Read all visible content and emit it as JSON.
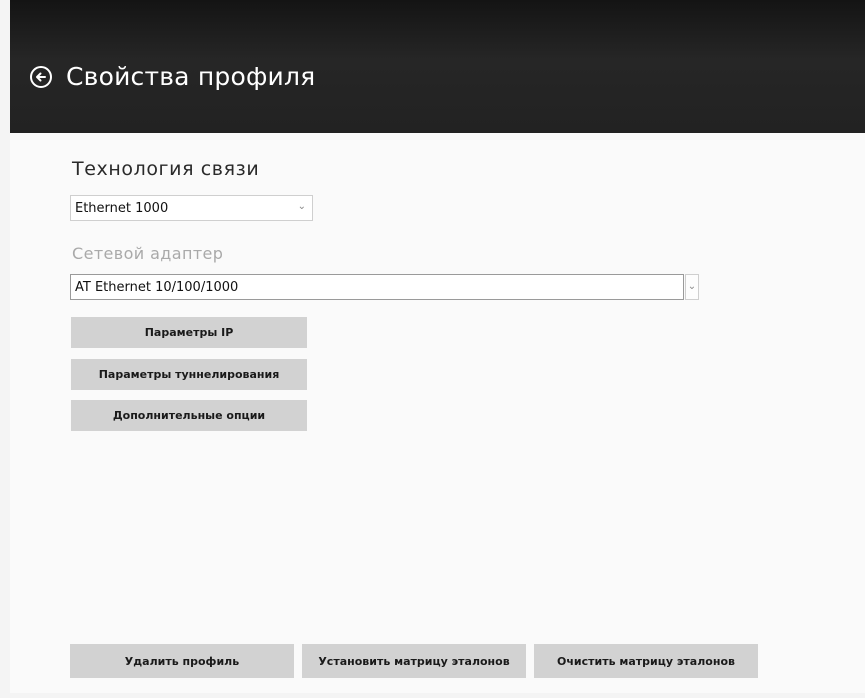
{
  "header": {
    "title": "Свойства профиля",
    "back_icon": "back-arrow-circle-icon"
  },
  "technology": {
    "label": "Технология связи",
    "selected": "Ethernet 1000"
  },
  "adapter": {
    "label": "Сетевой адаптер",
    "selected": "AT Ethernet 10/100/1000"
  },
  "buttons": {
    "ip_params": "Параметры IP",
    "tunnel_params": "Параметры туннелирования",
    "extra_options": "Дополнительные опции"
  },
  "footer": {
    "delete_profile": "Удалить профиль",
    "set_matrix": "Установить матрицу эталонов",
    "clear_matrix": "Очистить матрицу эталонов"
  },
  "colors": {
    "header_bg": "#1e1e1e",
    "button_bg": "#d2d2d2",
    "content_bg": "#fafafa"
  }
}
